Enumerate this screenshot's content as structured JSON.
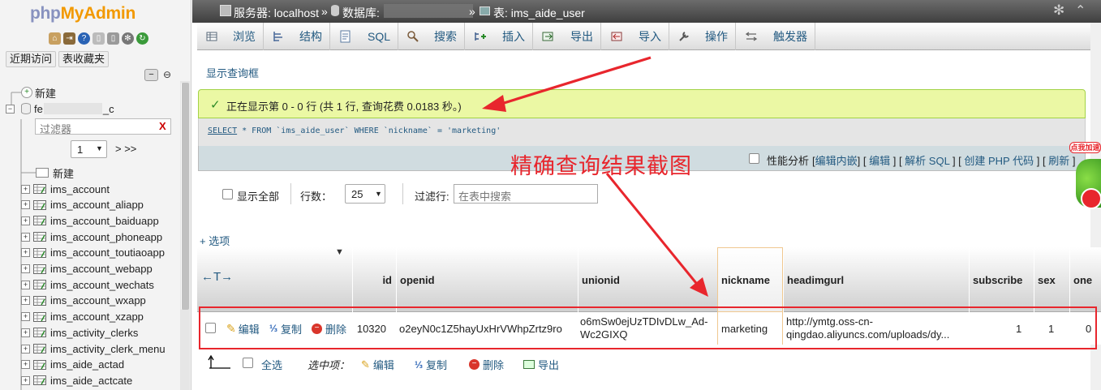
{
  "logo": {
    "part1": "php",
    "part2": "MyAdmin"
  },
  "left": {
    "recent_button": "近期访问",
    "favorites_button": "表收藏夹",
    "tree_new": "新建",
    "db_name_prefix": "fe",
    "db_name_suffix": "_c",
    "filter_placeholder": "过滤器",
    "filter_clear": "X",
    "page_select": "1",
    "page_nav": "> >>",
    "table_new": "新建",
    "tables": [
      "ims_account",
      "ims_account_aliapp",
      "ims_account_baiduapp",
      "ims_account_phoneapp",
      "ims_account_toutiaoapp",
      "ims_account_webapp",
      "ims_account_wechats",
      "ims_account_wxapp",
      "ims_account_xzapp",
      "ims_activity_clerks",
      "ims_activity_clerk_menu",
      "ims_aide_actad",
      "ims_aide_actcate"
    ]
  },
  "topbar": {
    "server_label": "服务器: localhost",
    "sep1": "»",
    "db_label": "数据库:",
    "sep2": "»",
    "table_label": "表: ims_aide_user"
  },
  "tabs": [
    {
      "label": "浏览",
      "icon": "browse-icon"
    },
    {
      "label": "结构",
      "icon": "structure-icon"
    },
    {
      "label": "SQL",
      "icon": "sql-icon"
    },
    {
      "label": "搜索",
      "icon": "search-icon"
    },
    {
      "label": "插入",
      "icon": "insert-icon"
    },
    {
      "label": "导出",
      "icon": "export-icon"
    },
    {
      "label": "导入",
      "icon": "import-icon"
    },
    {
      "label": "操作",
      "icon": "operations-icon"
    },
    {
      "label": "触发器",
      "icon": "triggers-icon"
    }
  ],
  "show_query_box": "显示查询框",
  "success_message": "正在显示第 0 - 0 行 (共 1 行, 查询花费 0.0183 秒。)",
  "sql": {
    "keyword": "SELECT",
    "rest": " * FROM `ims_aide_user` WHERE `nickname` = 'marketing'"
  },
  "actions": {
    "profiling": "性能分析",
    "edit_inline": "编辑内嵌",
    "edit": "编辑",
    "explain": "解析 SQL",
    "create_php": "创建 PHP 代码",
    "refresh": "刷新"
  },
  "controls": {
    "show_all": "显示全部",
    "rows_label": "行数：",
    "rows_value": "25",
    "filter_label": "过滤行:",
    "filter_placeholder": "在表中搜索",
    "options": "+ 选项"
  },
  "table": {
    "columns": [
      "id",
      "openid",
      "unionid",
      "nickname",
      "headimgurl",
      "subscribe",
      "sex",
      "one"
    ],
    "sort_arrows": "←T→",
    "row": {
      "edit": "编辑",
      "copy": "复制",
      "delete": "删除",
      "id": "10320",
      "openid": "o2eyN0c1Z5hayUxHrVWhpZrtz9ro",
      "unionid_line1": "o6mSw0ejUzTDIvDLw_Ad-",
      "unionid_line2": "Wc2GIXQ",
      "nickname": "marketing",
      "headimgurl_line1": "http://ymtg.oss-cn-",
      "headimgurl_line2": "qingdao.aliyuncs.com/uploads/dy...",
      "subscribe": "1",
      "sex": "1",
      "one": "0"
    }
  },
  "bulk": {
    "select_all": "全选",
    "selected_label": "选中项：",
    "edit": "编辑",
    "copy": "复制",
    "delete": "删除",
    "export": "导出"
  },
  "annotation": "精确查询结果截图",
  "badge_text": "点我加速",
  "colors": {
    "link": "#235a81",
    "annotation": "#e8262d",
    "success_bg": "#ebf8a4"
  }
}
